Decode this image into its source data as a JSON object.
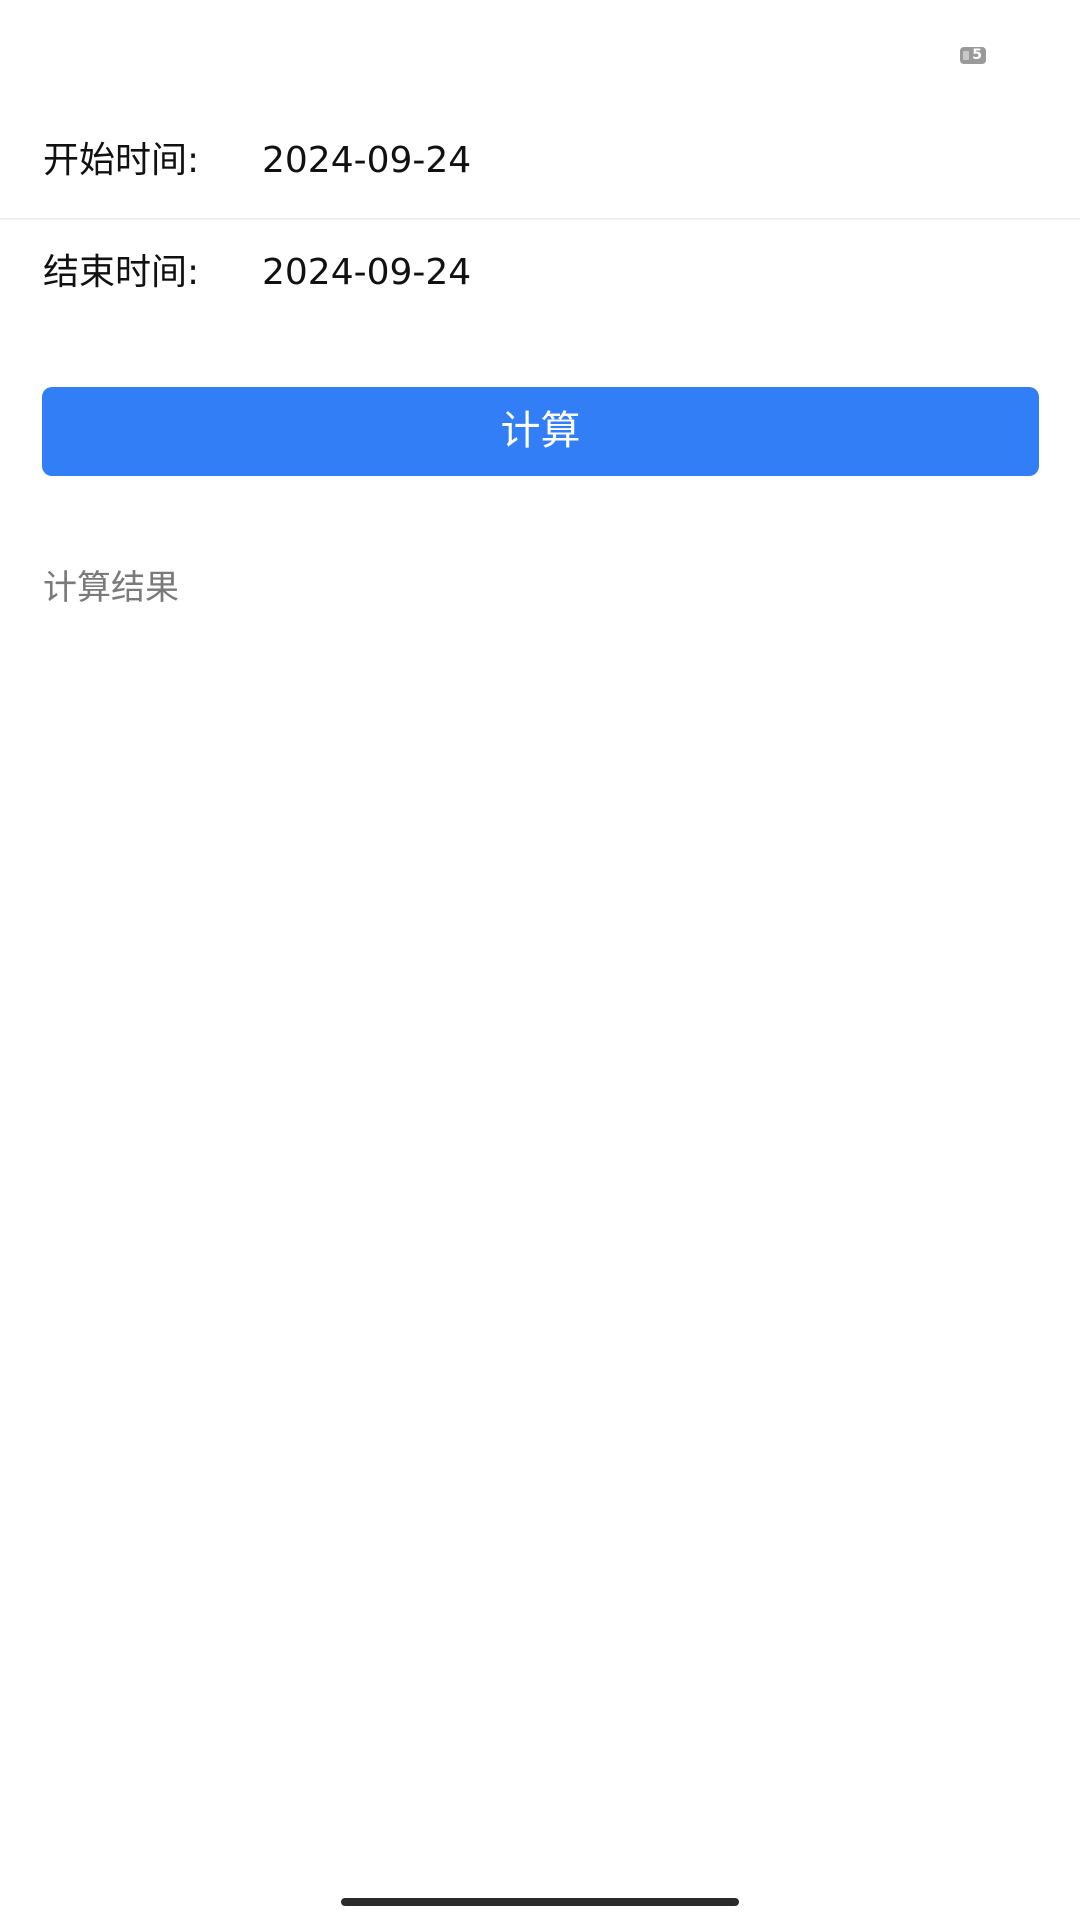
{
  "status_bar": {
    "battery_level": "5",
    "battery_icon": "battery-icon"
  },
  "form": {
    "start": {
      "label": "开始时间:",
      "value": "2024-09-24"
    },
    "end": {
      "label": "结束时间:",
      "value": "2024-09-24"
    }
  },
  "actions": {
    "calculate_label": "计算"
  },
  "result": {
    "label": "计算结果"
  },
  "colors": {
    "accent": "#327ef6",
    "text_primary": "#111111",
    "text_secondary": "#7a7a7a",
    "background": "#ffffff"
  }
}
